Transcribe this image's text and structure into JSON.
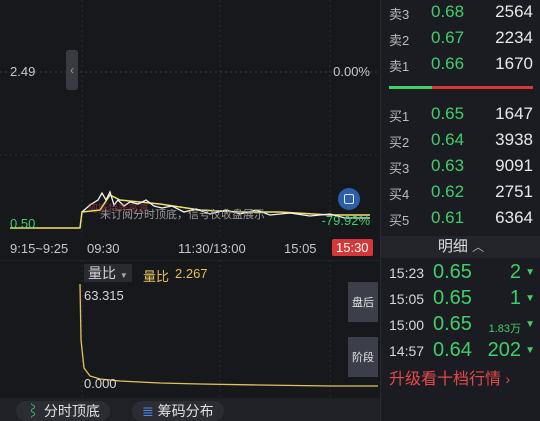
{
  "price_chart": {
    "ref_price": "2.49",
    "ref_pct": "0.00%",
    "low_price": "0.50",
    "low_pct": "-79.92%",
    "overlay_text": "未订阅分时顶底，信号仅收盘展示",
    "faint_text": "阿斯特弄来源"
  },
  "time_axis": [
    "9:15~9:25",
    "09:30",
    "11:30/13:00",
    "15:05",
    "15:30"
  ],
  "volume": {
    "dropdown_label": "量比",
    "value_label": "量比",
    "value": "2.267",
    "max": "63.315",
    "min": "0.000"
  },
  "side_buttons": [
    "盘后",
    "阶段"
  ],
  "bottom_tabs": [
    "分时顶底",
    "筹码分布"
  ],
  "orderbook": {
    "asks": [
      {
        "name": "卖3",
        "price": "0.68",
        "vol": "2564"
      },
      {
        "name": "卖2",
        "price": "0.67",
        "vol": "2234"
      },
      {
        "name": "卖1",
        "price": "0.66",
        "vol": "1670"
      }
    ],
    "bids": [
      {
        "name": "买1",
        "price": "0.65",
        "vol": "1647"
      },
      {
        "name": "买2",
        "price": "0.64",
        "vol": "3938"
      },
      {
        "name": "买3",
        "price": "0.63",
        "vol": "9091"
      },
      {
        "name": "买4",
        "price": "0.62",
        "vol": "2751"
      },
      {
        "name": "买5",
        "price": "0.61",
        "vol": "6364"
      }
    ]
  },
  "detail_label": "明细",
  "trades": [
    {
      "time": "15:23",
      "price": "0.65",
      "vol": "2"
    },
    {
      "time": "15:05",
      "price": "0.65",
      "vol": "1"
    },
    {
      "time": "15:00",
      "price": "0.65",
      "vol": "1.83万"
    },
    {
      "time": "14:57",
      "price": "0.64",
      "vol": "202"
    }
  ],
  "upgrade_text": "升级看十档行情",
  "colors": {
    "up": "#e54d4d",
    "down": "#3fce6b",
    "accent": "#f2c94c"
  }
}
